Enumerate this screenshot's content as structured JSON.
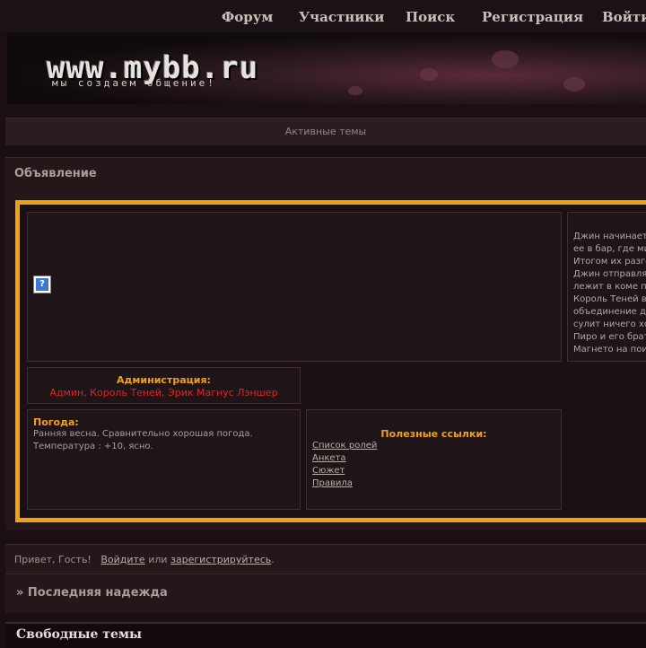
{
  "nav": {
    "items": [
      "Форум",
      "Участники",
      "Поиск",
      "Регистрация",
      "Войти"
    ]
  },
  "banner": {
    "logo": "www.mybb.ru",
    "slogan": "мы создаем общение!"
  },
  "active_topics": "Активные темы",
  "announcement": {
    "title": "Объявление",
    "story_lines": [
      "Джин начинает",
      "ее в бар, где ми",
      "Итогом их разго",
      "Джин отправля",
      "лежит в коме п",
      "Король Теней в",
      "объединение д",
      "сулит ничего хо",
      "Пиро и его брат",
      "Магнето на пои"
    ],
    "admin_title": "Администрация:",
    "admin_names": "Админ, Король Теней, Эрик Магнус Лэншер",
    "weather_title": "Погода:",
    "weather_lines": [
      "Ранняя весна. Сравнительно хорошая погода.",
      "Температура : +10, ясно."
    ],
    "links_title": "Полезные ссылки:",
    "links": [
      "Список ролей",
      "Анкета",
      "Сюжет",
      "Правила"
    ]
  },
  "guest": {
    "greeting": "Привет, Гость!",
    "login": "Войдите",
    "or": "или",
    "register": "зарегистрируйтесь",
    "period": "."
  },
  "breadcrumb": "» Последняя надежда",
  "section_title": "Свободные темы",
  "colors": {
    "accent_orange": "#f0a214",
    "admin_red": "#e0261e"
  }
}
